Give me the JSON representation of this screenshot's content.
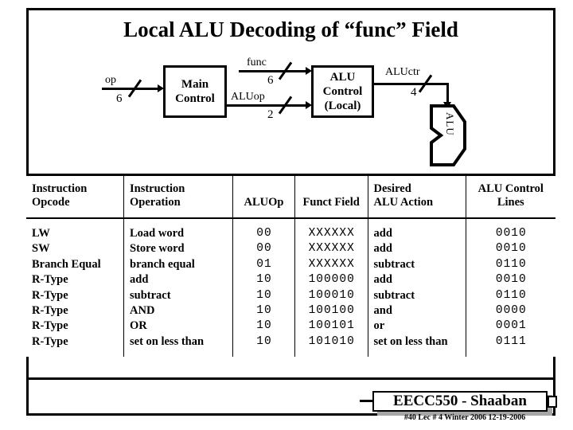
{
  "slide": {
    "title": "Local ALU Decoding of “func” Field"
  },
  "diagram": {
    "blocks": [
      {
        "id": "main-control",
        "line1": "Main",
        "line2": "Control",
        "line3": ""
      },
      {
        "id": "alu-control",
        "line1": "ALU",
        "line2": "Control",
        "line3": "(Local)"
      }
    ],
    "alu_label": "ALU",
    "signals": [
      {
        "name": "op",
        "bits": "6"
      },
      {
        "name": "func",
        "bits": "6"
      },
      {
        "name": "ALUop",
        "bits": "2"
      },
      {
        "name": "ALUctr",
        "bits": "4"
      }
    ]
  },
  "table": {
    "headers": [
      "Instruction\nOpcode",
      "Instruction\nOperation",
      "ALUOp",
      "Funct Field",
      "Desired\nALU Action",
      "ALU Control\nLines"
    ],
    "rows": [
      {
        "opcode": "LW",
        "operation": "Load word",
        "aluop": "00",
        "funct": "XXXXXX",
        "action": "add",
        "lines": "0010"
      },
      {
        "opcode": "SW",
        "operation": "Store word",
        "aluop": "00",
        "funct": "XXXXXX",
        "action": "add",
        "lines": "0010"
      },
      {
        "opcode": "Branch Equal",
        "operation": "branch equal",
        "aluop": "01",
        "funct": "XXXXXX",
        "action": "subtract",
        "lines": "0110"
      },
      {
        "opcode": "R-Type",
        "operation": "add",
        "aluop": "10",
        "funct": "100000",
        "action": "add",
        "lines": "0010"
      },
      {
        "opcode": "R-Type",
        "operation": "subtract",
        "aluop": "10",
        "funct": "100010",
        "action": "subtract",
        "lines": "0110"
      },
      {
        "opcode": "R-Type",
        "operation": "AND",
        "aluop": "10",
        "funct": "100100",
        "action": "and",
        "lines": "0000"
      },
      {
        "opcode": "R-Type",
        "operation": "OR",
        "aluop": "10",
        "funct": "100101",
        "action": "or",
        "lines": "0001"
      },
      {
        "opcode": "R-Type",
        "operation": "set on less than",
        "aluop": "10",
        "funct": "101010",
        "action": "set on less than",
        "lines": "0111"
      }
    ]
  },
  "footer": {
    "course": "EECC550 - Shaaban",
    "subline": "#40   Lec # 4   Winter 2006   12-19-2006"
  },
  "colors": {
    "ink": "#000000",
    "paper": "#ffffff",
    "shadow": "#a6a6a6"
  }
}
